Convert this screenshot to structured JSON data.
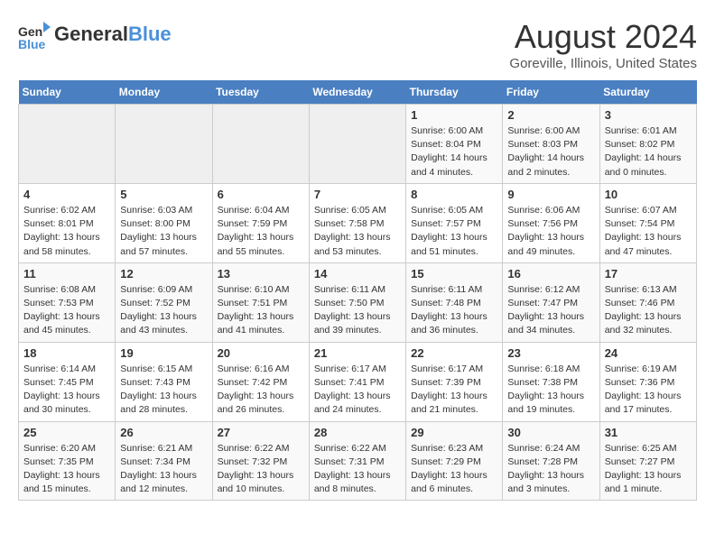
{
  "header": {
    "logo_line1": "General",
    "logo_line2": "Blue",
    "month_year": "August 2024",
    "location": "Goreville, Illinois, United States"
  },
  "days_of_week": [
    "Sunday",
    "Monday",
    "Tuesday",
    "Wednesday",
    "Thursday",
    "Friday",
    "Saturday"
  ],
  "weeks": [
    [
      {
        "day": "",
        "info": ""
      },
      {
        "day": "",
        "info": ""
      },
      {
        "day": "",
        "info": ""
      },
      {
        "day": "",
        "info": ""
      },
      {
        "day": "1",
        "info": "Sunrise: 6:00 AM\nSunset: 8:04 PM\nDaylight: 14 hours\nand 4 minutes."
      },
      {
        "day": "2",
        "info": "Sunrise: 6:00 AM\nSunset: 8:03 PM\nDaylight: 14 hours\nand 2 minutes."
      },
      {
        "day": "3",
        "info": "Sunrise: 6:01 AM\nSunset: 8:02 PM\nDaylight: 14 hours\nand 0 minutes."
      }
    ],
    [
      {
        "day": "4",
        "info": "Sunrise: 6:02 AM\nSunset: 8:01 PM\nDaylight: 13 hours\nand 58 minutes."
      },
      {
        "day": "5",
        "info": "Sunrise: 6:03 AM\nSunset: 8:00 PM\nDaylight: 13 hours\nand 57 minutes."
      },
      {
        "day": "6",
        "info": "Sunrise: 6:04 AM\nSunset: 7:59 PM\nDaylight: 13 hours\nand 55 minutes."
      },
      {
        "day": "7",
        "info": "Sunrise: 6:05 AM\nSunset: 7:58 PM\nDaylight: 13 hours\nand 53 minutes."
      },
      {
        "day": "8",
        "info": "Sunrise: 6:05 AM\nSunset: 7:57 PM\nDaylight: 13 hours\nand 51 minutes."
      },
      {
        "day": "9",
        "info": "Sunrise: 6:06 AM\nSunset: 7:56 PM\nDaylight: 13 hours\nand 49 minutes."
      },
      {
        "day": "10",
        "info": "Sunrise: 6:07 AM\nSunset: 7:54 PM\nDaylight: 13 hours\nand 47 minutes."
      }
    ],
    [
      {
        "day": "11",
        "info": "Sunrise: 6:08 AM\nSunset: 7:53 PM\nDaylight: 13 hours\nand 45 minutes."
      },
      {
        "day": "12",
        "info": "Sunrise: 6:09 AM\nSunset: 7:52 PM\nDaylight: 13 hours\nand 43 minutes."
      },
      {
        "day": "13",
        "info": "Sunrise: 6:10 AM\nSunset: 7:51 PM\nDaylight: 13 hours\nand 41 minutes."
      },
      {
        "day": "14",
        "info": "Sunrise: 6:11 AM\nSunset: 7:50 PM\nDaylight: 13 hours\nand 39 minutes."
      },
      {
        "day": "15",
        "info": "Sunrise: 6:11 AM\nSunset: 7:48 PM\nDaylight: 13 hours\nand 36 minutes."
      },
      {
        "day": "16",
        "info": "Sunrise: 6:12 AM\nSunset: 7:47 PM\nDaylight: 13 hours\nand 34 minutes."
      },
      {
        "day": "17",
        "info": "Sunrise: 6:13 AM\nSunset: 7:46 PM\nDaylight: 13 hours\nand 32 minutes."
      }
    ],
    [
      {
        "day": "18",
        "info": "Sunrise: 6:14 AM\nSunset: 7:45 PM\nDaylight: 13 hours\nand 30 minutes."
      },
      {
        "day": "19",
        "info": "Sunrise: 6:15 AM\nSunset: 7:43 PM\nDaylight: 13 hours\nand 28 minutes."
      },
      {
        "day": "20",
        "info": "Sunrise: 6:16 AM\nSunset: 7:42 PM\nDaylight: 13 hours\nand 26 minutes."
      },
      {
        "day": "21",
        "info": "Sunrise: 6:17 AM\nSunset: 7:41 PM\nDaylight: 13 hours\nand 24 minutes."
      },
      {
        "day": "22",
        "info": "Sunrise: 6:17 AM\nSunset: 7:39 PM\nDaylight: 13 hours\nand 21 minutes."
      },
      {
        "day": "23",
        "info": "Sunrise: 6:18 AM\nSunset: 7:38 PM\nDaylight: 13 hours\nand 19 minutes."
      },
      {
        "day": "24",
        "info": "Sunrise: 6:19 AM\nSunset: 7:36 PM\nDaylight: 13 hours\nand 17 minutes."
      }
    ],
    [
      {
        "day": "25",
        "info": "Sunrise: 6:20 AM\nSunset: 7:35 PM\nDaylight: 13 hours\nand 15 minutes."
      },
      {
        "day": "26",
        "info": "Sunrise: 6:21 AM\nSunset: 7:34 PM\nDaylight: 13 hours\nand 12 minutes."
      },
      {
        "day": "27",
        "info": "Sunrise: 6:22 AM\nSunset: 7:32 PM\nDaylight: 13 hours\nand 10 minutes."
      },
      {
        "day": "28",
        "info": "Sunrise: 6:22 AM\nSunset: 7:31 PM\nDaylight: 13 hours\nand 8 minutes."
      },
      {
        "day": "29",
        "info": "Sunrise: 6:23 AM\nSunset: 7:29 PM\nDaylight: 13 hours\nand 6 minutes."
      },
      {
        "day": "30",
        "info": "Sunrise: 6:24 AM\nSunset: 7:28 PM\nDaylight: 13 hours\nand 3 minutes."
      },
      {
        "day": "31",
        "info": "Sunrise: 6:25 AM\nSunset: 7:27 PM\nDaylight: 13 hours\nand 1 minute."
      }
    ]
  ]
}
